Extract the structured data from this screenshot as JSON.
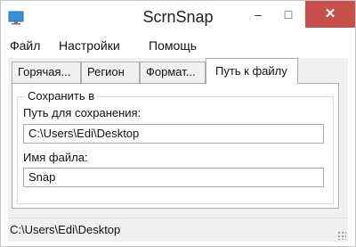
{
  "window": {
    "title": "ScrnSnap",
    "app_icon": "monitor-icon",
    "controls": {
      "minimize": "–",
      "maximize": "□",
      "close": "✕"
    }
  },
  "menu": {
    "items": [
      "Файл",
      "Настройки",
      "Помощь"
    ]
  },
  "tabs": [
    {
      "label": "Горячая..."
    },
    {
      "label": "Регион"
    },
    {
      "label": "Формат..."
    },
    {
      "label": "Путь к файлу",
      "active": true
    }
  ],
  "group": {
    "title": "Сохранить в",
    "path_label": "Путь для сохранения:",
    "path_value": "C:\\Users\\Edi\\Desktop",
    "filename_label": "Имя файла:",
    "filename_value": "Snap"
  },
  "status": {
    "text": "C:\\Users\\Edi\\Desktop"
  },
  "colors": {
    "close_button": "#c7504a",
    "border": "#adadad",
    "client_bg": "#f0f0f0"
  }
}
